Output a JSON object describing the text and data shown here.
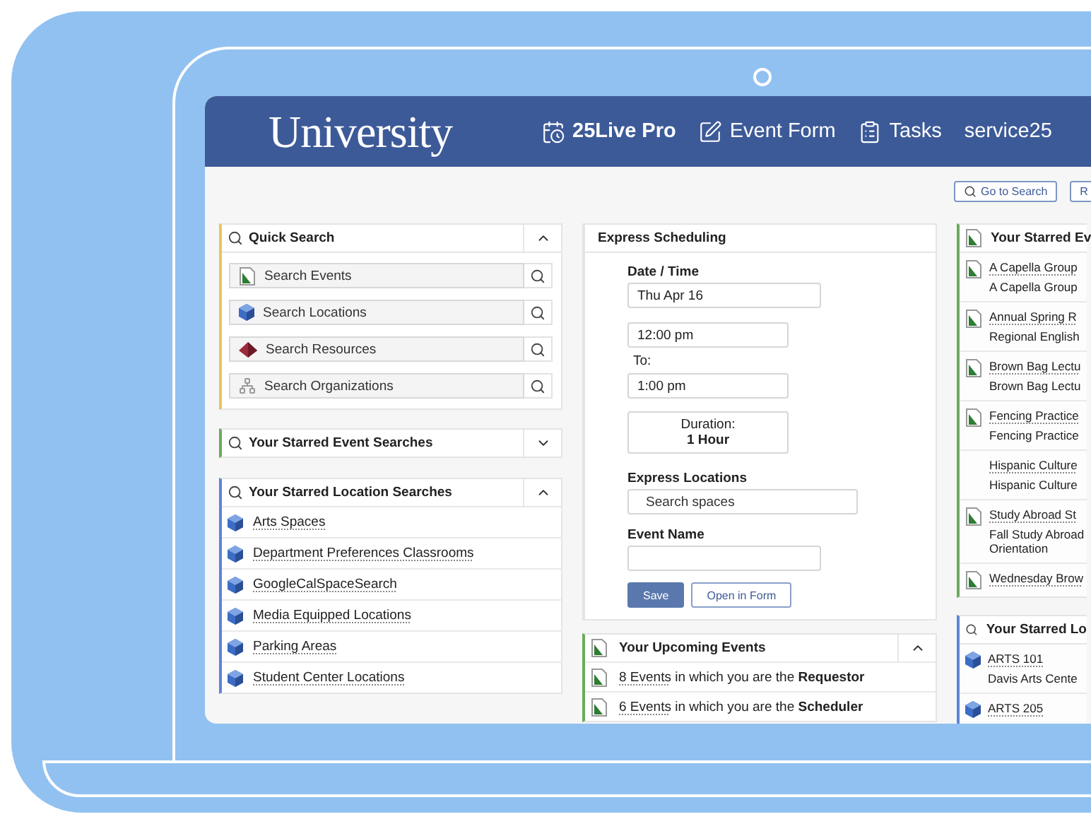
{
  "header": {
    "logo": "University",
    "nav": [
      {
        "kind": "calendar",
        "label": "25Live Pro",
        "selected": true
      },
      {
        "kind": "form",
        "label": "Event Form",
        "selected": false
      },
      {
        "kind": "tasks",
        "label": "Tasks",
        "selected": false
      },
      {
        "kind": "user",
        "label": "service25",
        "selected": false
      }
    ]
  },
  "toolbar": [
    "Go to Search",
    "R"
  ],
  "quick_search": {
    "title": "Quick Search",
    "expanded": true,
    "items": [
      {
        "kind": "events",
        "label": "Search Events"
      },
      {
        "kind": "locations",
        "label": "Search Locations"
      },
      {
        "kind": "resources",
        "label": "Search Resources"
      },
      {
        "kind": "organizations",
        "label": "Search Organizations"
      }
    ]
  },
  "starred_event_searches": {
    "title": "Your Starred Event Searches",
    "expanded": false
  },
  "starred_location_searches": {
    "title": "Your Starred Location Searches",
    "expanded": true,
    "items": [
      "Arts Spaces",
      "Department Preferences Classrooms",
      "GoogleCalSpaceSearch",
      "Media Equipped Locations",
      "Parking Areas",
      "Student Center Locations"
    ]
  },
  "express_scheduling": {
    "title": "Express Scheduling",
    "date_label": "Date / Time",
    "date": "Thu Apr 16",
    "start": "12:00 pm",
    "to_label": "To:",
    "end": "1:00 pm",
    "duration_label": "Duration:",
    "duration": "1 Hour",
    "locations_label": "Express Locations",
    "locations_placeholder": "Search spaces",
    "name_label": "Event Name",
    "buttons": [
      "Save",
      "Open in Form"
    ]
  },
  "upcoming_events": {
    "title": "Your Upcoming Events",
    "expanded": true,
    "rows": [
      {
        "link": "8 Events",
        "text": "in which you are the **Requestor**"
      },
      {
        "link": "6 Events",
        "text": "in which you are the **Scheduler**"
      }
    ]
  },
  "starred_events": {
    "title": "Your Starred Ev",
    "items": [
      {
        "has_icon": true,
        "title": "A Capella Group",
        "subtitle": "A Capella Group"
      },
      {
        "has_icon": true,
        "title": "Annual Spring R",
        "subtitle": "Regional English"
      },
      {
        "has_icon": true,
        "title": "Brown Bag Lectu",
        "subtitle": "Brown Bag Lectu"
      },
      {
        "has_icon": true,
        "title": "Fencing Practice",
        "subtitle": "Fencing Practice"
      },
      {
        "has_icon": false,
        "title": "Hispanic Culture",
        "subtitle": "Hispanic Culture"
      },
      {
        "has_icon": true,
        "title": "Study Abroad St",
        "subtitle": "Fall Study Abroad Orientation"
      },
      {
        "has_icon": true,
        "title": "Wednesday Brow"
      }
    ]
  },
  "starred_locations": {
    "title": "Your Starred Lo",
    "items": [
      {
        "title": "ARTS 101",
        "subtitle": "Davis Arts Cente"
      },
      {
        "title": "ARTS 205"
      }
    ]
  }
}
